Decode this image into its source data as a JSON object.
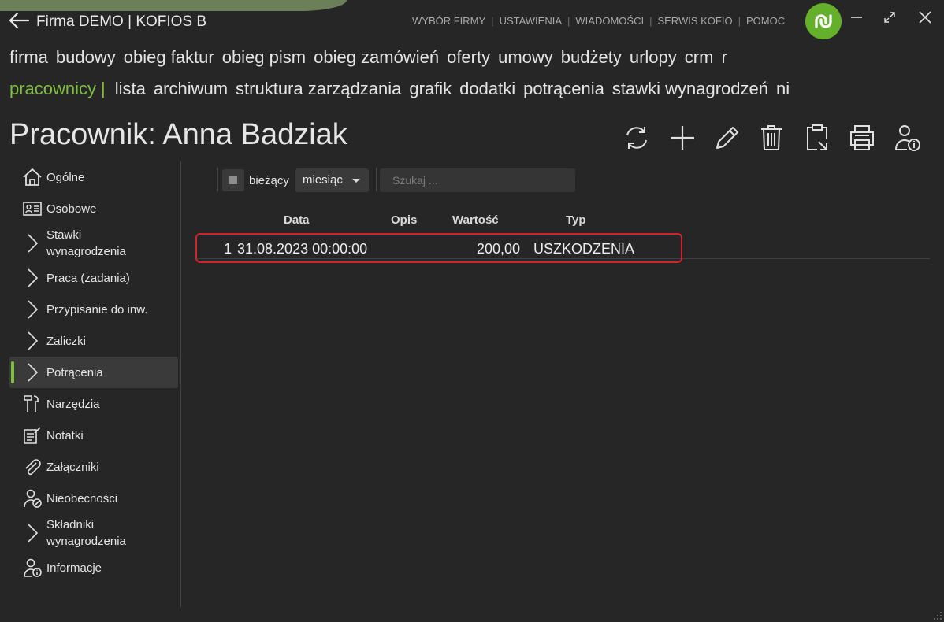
{
  "window": {
    "title": "Firma DEMO | KOFIOS B",
    "top_links": [
      "WYBÓR FIRMY",
      "USTAWIENIA",
      "WIADOMOŚCI",
      "SERWIS KOFIO",
      "POMOC"
    ],
    "top_link_separator": "|"
  },
  "menu_main": [
    "firma",
    "budowy",
    "obieg faktur",
    "obieg pism",
    "obieg zamówień",
    "oferty",
    "umowy",
    "budżety",
    "urlopy",
    "crm",
    "r"
  ],
  "menu_sub": {
    "active": "pracownicy",
    "separator": "|",
    "items": [
      "lista",
      "archiwum",
      "struktura zarządzania",
      "grafik",
      "dodatki",
      "potrącenia",
      "stawki wynagrodzeń",
      "nieob"
    ]
  },
  "page": {
    "title": "Pracownik: Anna Badziak"
  },
  "toolbar": [
    "refresh-icon",
    "add-icon",
    "edit-icon",
    "delete-icon",
    "clipboard-icon",
    "print-icon",
    "user-info-icon"
  ],
  "sidebar": {
    "items": [
      {
        "label": "Ogólne",
        "icon": "home-icon"
      },
      {
        "label": "Osobowe",
        "icon": "id-card-icon"
      },
      {
        "label": "Stawki\nwynagrodzenia",
        "icon": "chevron-right-icon"
      },
      {
        "label": "Praca (zadania)",
        "icon": "chevron-right-icon"
      },
      {
        "label": "Przypisanie do inw.",
        "icon": "chevron-right-icon"
      },
      {
        "label": "Zaliczki",
        "icon": "chevron-right-icon"
      },
      {
        "label": "Potrącenia",
        "icon": "chevron-right-icon",
        "active": true
      },
      {
        "label": "Narzędzia",
        "icon": "tools-icon"
      },
      {
        "label": "Notatki",
        "icon": "notes-icon"
      },
      {
        "label": "Załączniki",
        "icon": "paperclip-icon"
      },
      {
        "label": "Nieobecności",
        "icon": "user-absence-icon"
      },
      {
        "label": "Składniki\nwynagrodzenia",
        "icon": "chevron-right-icon"
      },
      {
        "label": "Informacje",
        "icon": "user-info-icon"
      }
    ]
  },
  "filters": {
    "current_label": "bieżący",
    "period_value": "miesiąc",
    "search_placeholder": "Szukaj ..."
  },
  "table": {
    "columns": [
      "Data",
      "Opis",
      "Wartość",
      "Typ"
    ],
    "rows": [
      {
        "index": "1",
        "date": "31.08.2023 00:00:00",
        "description": "",
        "value": "200,00",
        "type": "USZKODZENIA"
      }
    ]
  },
  "colors": {
    "accent": "#7fbf3f",
    "logo": "#64b02b",
    "background": "#262626",
    "highlight_border": "#d2222b"
  }
}
